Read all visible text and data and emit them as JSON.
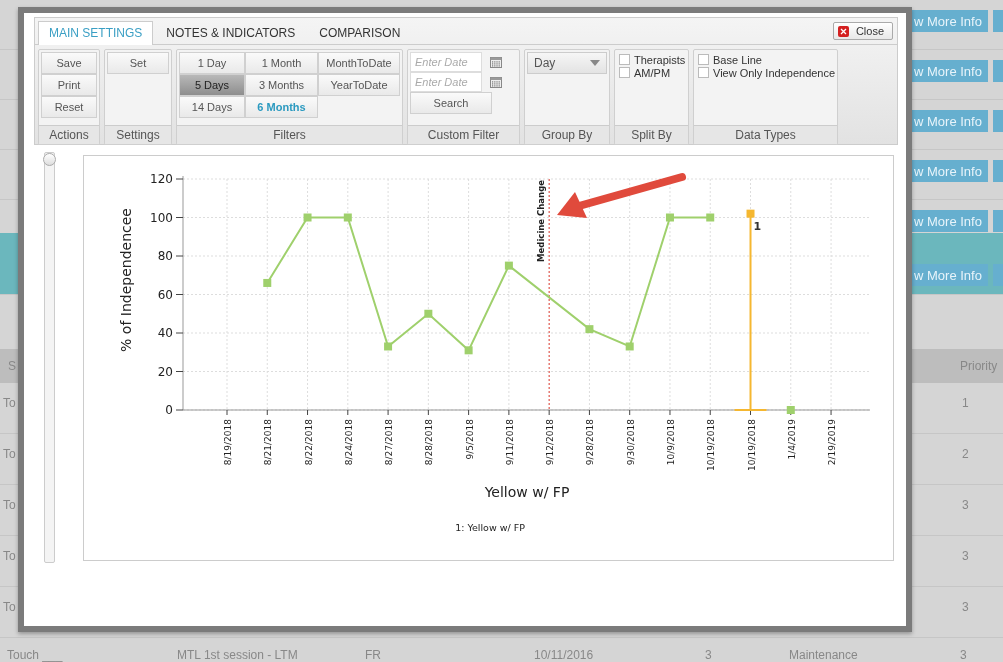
{
  "background_page": {
    "info_rows": [
      {
        "button": "w More Info",
        "highlighted": false
      },
      {
        "button": "w More Info",
        "highlighted": false
      },
      {
        "button": "w More Info",
        "highlighted": false
      },
      {
        "button": "w More Info",
        "highlighted": false
      },
      {
        "button": "w More Info",
        "highlighted": false
      },
      {
        "button": "w More Info",
        "highlighted": true
      }
    ],
    "table": {
      "columns": [
        "S",
        "Priority"
      ],
      "rows": [
        {
          "cell_1": "To",
          "priority": "1"
        },
        {
          "cell_1": "To",
          "priority": "2"
        },
        {
          "cell_1": "To",
          "priority": "3"
        },
        {
          "cell_1": "To",
          "priority": "3"
        },
        {
          "cell_1": "To",
          "priority": "3"
        }
      ],
      "last_row": [
        "Touch ___",
        "MTL 1st session - LTM",
        "FR",
        "10/11/2016",
        "3",
        "Maintenance",
        "3"
      ]
    }
  },
  "dialog": {
    "tabs": [
      {
        "label": "MAIN SETTINGS",
        "selected": true
      },
      {
        "label": "NOTES & INDICATORS",
        "selected": false
      },
      {
        "label": "COMPARISON",
        "selected": false
      }
    ],
    "close_button": "Close",
    "groups": [
      {
        "kind": "buttons",
        "title": "Actions",
        "buttons": [
          "Save",
          "Print",
          "Reset"
        ]
      },
      {
        "kind": "buttons",
        "title": "Settings",
        "buttons": [
          "Set"
        ]
      },
      {
        "kind": "filters",
        "title": "Filters",
        "columns": [
          [
            {
              "label": "1 Day",
              "selected": false,
              "pressed": false
            },
            {
              "label": "5 Days",
              "selected": false,
              "pressed": true
            },
            {
              "label": "14 Days",
              "selected": false,
              "pressed": false
            }
          ],
          [
            {
              "label": "1 Month",
              "selected": false,
              "pressed": false
            },
            {
              "label": "3 Months",
              "selected": false,
              "pressed": false
            },
            {
              "label": "6 Months",
              "selected": true,
              "pressed": false
            }
          ],
          [
            {
              "label": "MonthToDate",
              "selected": false,
              "pressed": false
            },
            {
              "label": "YearToDate",
              "selected": false,
              "pressed": false
            }
          ]
        ]
      },
      {
        "kind": "dates",
        "title": "Custom Filter",
        "fields": [
          {
            "placeholder": "Enter Date"
          },
          {
            "placeholder": "Enter Date"
          }
        ],
        "button": "Search"
      },
      {
        "kind": "select",
        "title": "Group By",
        "value": "Day"
      },
      {
        "kind": "checks",
        "title": "Split By",
        "items": [
          {
            "label": "Therapists",
            "checked": false
          },
          {
            "label": "AM/PM",
            "checked": false
          }
        ]
      },
      {
        "kind": "checks",
        "title": "Data Types",
        "items": [
          {
            "label": "Base Line",
            "checked": false
          },
          {
            "label": "View Only Independence",
            "checked": false
          }
        ]
      }
    ],
    "zoom_slider": {
      "level": 0
    },
    "chart": {
      "legend_note": "1: Yellow w/ FP",
      "chart_data": {
        "type": "line",
        "xlabel": "Yellow w/ FP",
        "ylabel": "% of Independencee",
        "categories": [
          "8/19/2018",
          "8/21/2018",
          "8/22/2018",
          "8/24/2018",
          "8/27/2018",
          "8/28/2018",
          "9/5/2018",
          "9/11/2018",
          "9/12/2018",
          "9/28/2018",
          "9/30/2018",
          "10/9/2018",
          "10/19/2018",
          "10/19/2018",
          "1/4/2019",
          "2/19/2019"
        ],
        "series": [
          {
            "color": "#9fd06c",
            "marker": "square",
            "values": [
              null,
              66,
              100,
              100,
              33,
              50,
              31,
              75,
              null,
              42,
              33,
              100,
              100,
              null,
              null,
              null
            ]
          },
          {
            "color": "#9fd06c",
            "marker": "square",
            "values": [
              null,
              null,
              null,
              null,
              null,
              null,
              null,
              null,
              null,
              null,
              null,
              null,
              null,
              null,
              0,
              null
            ]
          },
          {
            "color": "#f5b730",
            "marker": "square",
            "values": [
              null,
              null,
              null,
              null,
              null,
              null,
              null,
              null,
              null,
              null,
              null,
              null,
              null,
              102,
              null,
              null
            ],
            "errors": [
              null,
              null,
              null,
              null,
              null,
              null,
              null,
              null,
              null,
              null,
              null,
              null,
              null,
              [
                102,
                0
              ],
              null,
              null
            ]
          }
        ],
        "ylim": [
          0,
          120
        ],
        "yticks": [
          0,
          20,
          40,
          60,
          80,
          100,
          120
        ],
        "grid": true,
        "ref_lines": [
          {
            "axis": "x",
            "value": "9/12/2018",
            "label": "Medicine Change",
            "color": "#e8463c"
          }
        ],
        "annotations": [
          "1"
        ]
      }
    }
  }
}
